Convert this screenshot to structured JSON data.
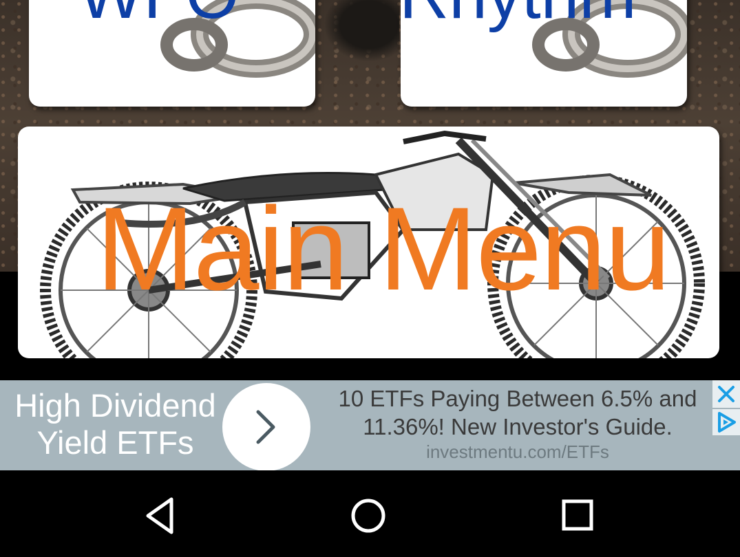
{
  "tiles": {
    "wfo_label": "WFO",
    "rhythm_label": "Rhythm",
    "main_menu_label": "Main Menu"
  },
  "ad": {
    "headline_line1": "High Dividend",
    "headline_line2": "Yield ETFs",
    "body_line1": "10 ETFs Paying Between 6.5% and",
    "body_line2": "11.36%! New Investor's Guide.",
    "url": "investmentu.com/ETFs",
    "close_icon": "close-icon",
    "adchoices_icon": "adchoices-icon"
  },
  "colors": {
    "tile_title_blue": "#0d3fa6",
    "main_menu_orange": "#f07a22",
    "ad_background": "#a7b6bd",
    "ad_icon_blue": "#1a9ee5"
  },
  "navbar": {
    "back_icon": "back-triangle-icon",
    "home_icon": "home-circle-icon",
    "recents_icon": "recents-square-icon"
  }
}
